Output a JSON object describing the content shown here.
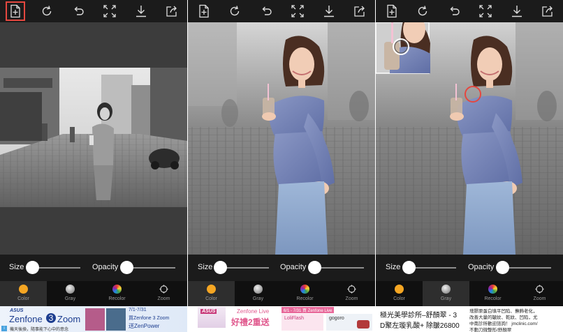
{
  "panels": [
    {
      "id": "panel-1",
      "selected_tool": "new-file",
      "active_mode": "color",
      "size_value": 0.02,
      "opacity_value": 0.02,
      "ad": {
        "brand": "ASUS",
        "product_main": "Zenfone",
        "product_num": "3",
        "product_word": "Zoom",
        "date_text": "7/1-7/31",
        "buy_text": "買Zenfone 3 Zoom",
        "gift_text": "送ZenPower",
        "fine_print": "機天後換，隨事能下心中的意念"
      }
    },
    {
      "id": "panel-2",
      "selected_tool": "",
      "active_mode": "color",
      "size_value": 0.02,
      "opacity_value": 0.02,
      "ad": {
        "brand": "ASUS",
        "product_main": "Zenfone Live",
        "promo_text": "好禮2重送",
        "item_1": "LoliFlash",
        "item_2": "gogoro",
        "date_text": "6/1 - 7/31 買 Zenfone Live"
      }
    },
    {
      "id": "panel-3",
      "selected_tool": "",
      "active_mode": "gray",
      "size_value": 0.02,
      "opacity_value": 0.02,
      "ad": {
        "line_1": "極光美學診所–舒顏翠 - 3",
        "line_2": "D聚左璇乳酸+ 除皺26800",
        "side_1": "增膠原蛋白填平凹陷、撫飾老化，",
        "side_2": "改善大量的皺紋、乾紋、凹陷，尤",
        "side_3": "中南診所歡迎諮詢！ jmclinic.com/",
        "side_4": "不動刀微整形/舒顏翠"
      }
    }
  ],
  "labels": {
    "size": "Size",
    "opacity": "Opacity",
    "modes": [
      {
        "key": "color",
        "label": "Color"
      },
      {
        "key": "gray",
        "label": "Gray"
      },
      {
        "key": "recolor",
        "label": "Recolor"
      },
      {
        "key": "zoom",
        "label": "Zoom"
      }
    ]
  },
  "tools": [
    {
      "key": "new-file",
      "icon": "new-file-icon"
    },
    {
      "key": "redo",
      "icon": "redo-icon"
    },
    {
      "key": "undo",
      "icon": "undo-icon"
    },
    {
      "key": "fit",
      "icon": "fit-screen-icon"
    },
    {
      "key": "download",
      "icon": "download-icon"
    },
    {
      "key": "share",
      "icon": "share-icon"
    }
  ],
  "colors": {
    "toolbar_bg": "#1b1b1b",
    "mode_bg": "#101010",
    "highlight": "#e5473f",
    "color_icon": "#f5a623"
  }
}
